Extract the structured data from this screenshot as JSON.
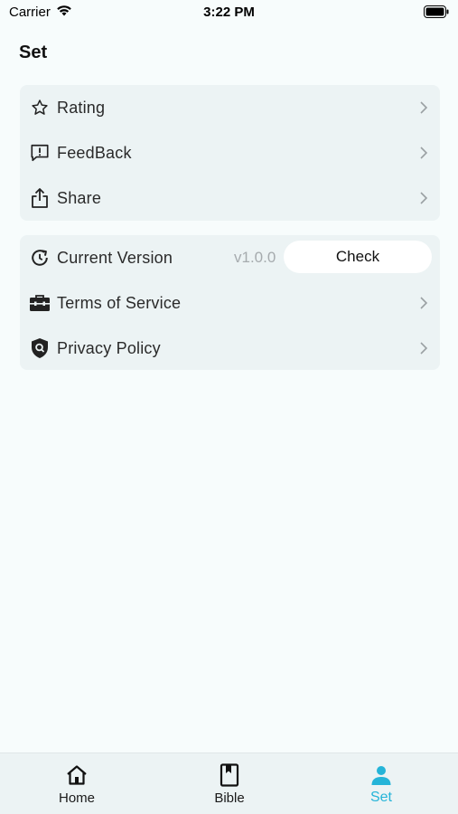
{
  "status_bar": {
    "carrier": "Carrier",
    "time": "3:22 PM"
  },
  "page": {
    "title": "Set"
  },
  "general_section": {
    "items": [
      {
        "label": "Rating",
        "icon": "star-icon"
      },
      {
        "label": "FeedBack",
        "icon": "feedback-icon"
      },
      {
        "label": "Share",
        "icon": "share-icon"
      }
    ]
  },
  "about_section": {
    "current_version": {
      "label": "Current Version",
      "value": "v1.0.0",
      "check_label": "Check",
      "icon": "version-check-icon"
    },
    "items": [
      {
        "label": "Terms of Service",
        "icon": "briefcase-icon"
      },
      {
        "label": "Privacy Policy",
        "icon": "shield-icon"
      }
    ]
  },
  "tab_bar": {
    "active_color": "#25b4d8",
    "tabs": [
      {
        "label": "Home",
        "icon": "home-icon",
        "active": false
      },
      {
        "label": "Bible",
        "icon": "book-icon",
        "active": false
      },
      {
        "label": "Set",
        "icon": "user-icon",
        "active": true
      }
    ]
  }
}
